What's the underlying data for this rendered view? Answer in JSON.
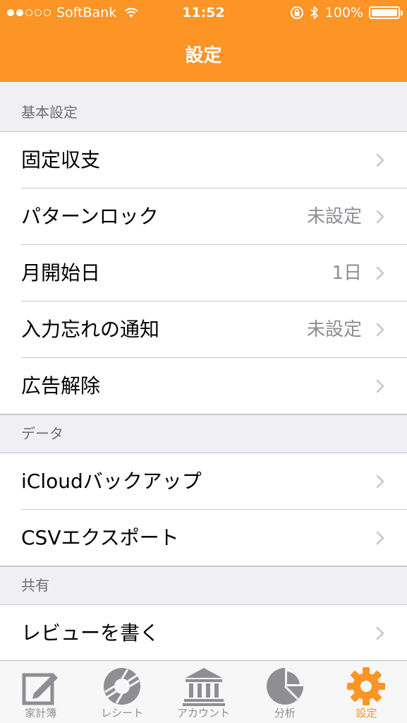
{
  "status_bar": {
    "carrier": "SoftBank",
    "time": "11:52",
    "battery": "100%",
    "battery_level": 1.0
  },
  "header": {
    "title": "設定"
  },
  "sections": [
    {
      "title": "基本設定",
      "rows": [
        {
          "label": "固定収支",
          "value": ""
        },
        {
          "label": "パターンロック",
          "value": "未設定"
        },
        {
          "label": "月開始日",
          "value": "1日"
        },
        {
          "label": "入力忘れの通知",
          "value": "未設定"
        },
        {
          "label": "広告解除",
          "value": ""
        }
      ]
    },
    {
      "title": "データ",
      "rows": [
        {
          "label": "iCloudバックアップ",
          "value": ""
        },
        {
          "label": "CSVエクスポート",
          "value": ""
        }
      ]
    },
    {
      "title": "共有",
      "rows": [
        {
          "label": "レビューを書く",
          "value": ""
        }
      ]
    }
  ],
  "tabs": [
    {
      "label": "家計簿",
      "icon": "edit-note-icon",
      "active": false
    },
    {
      "label": "レシート",
      "icon": "camera-shutter-icon",
      "active": false
    },
    {
      "label": "アカウント",
      "icon": "bank-icon",
      "active": false
    },
    {
      "label": "分析",
      "icon": "pie-chart-icon",
      "active": false
    },
    {
      "label": "設定",
      "icon": "gear-icon",
      "active": true
    }
  ],
  "colors": {
    "accent": "#fd9426",
    "inactive": "#8e8e93",
    "separator": "#c8c7cc",
    "background": "#efeff4"
  }
}
